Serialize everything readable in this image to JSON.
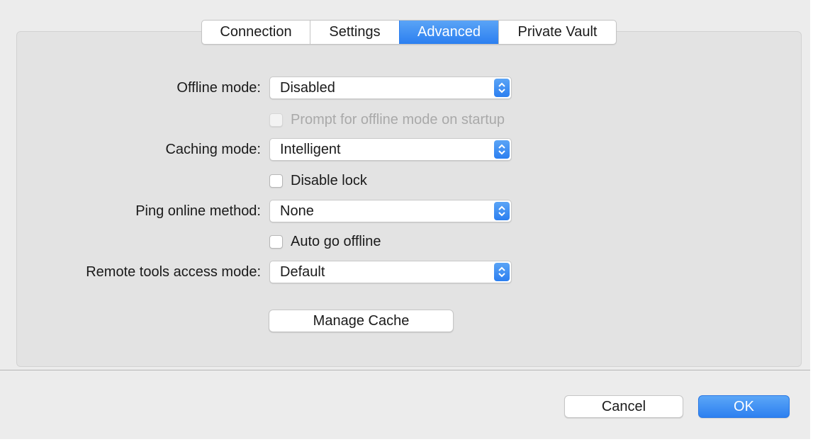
{
  "tabs": [
    {
      "label": "Connection",
      "active": false
    },
    {
      "label": "Settings",
      "active": false
    },
    {
      "label": "Advanced",
      "active": true
    },
    {
      "label": "Private Vault",
      "active": false
    }
  ],
  "form": {
    "offline_mode": {
      "label": "Offline mode:",
      "value": "Disabled"
    },
    "prompt_offline": {
      "label": "Prompt for offline mode on startup",
      "checked": false,
      "enabled": false
    },
    "caching_mode": {
      "label": "Caching mode:",
      "value": "Intelligent"
    },
    "disable_lock": {
      "label": "Disable lock",
      "checked": false,
      "enabled": true
    },
    "ping_method": {
      "label": "Ping online method:",
      "value": "None"
    },
    "auto_offline": {
      "label": "Auto go offline",
      "checked": false,
      "enabled": true
    },
    "remote_tools": {
      "label": "Remote tools access mode:",
      "value": "Default"
    },
    "manage_cache_label": "Manage Cache"
  },
  "footer": {
    "cancel_label": "Cancel",
    "ok_label": "OK"
  },
  "icons": {
    "select_chevron": "chevron-updown-icon"
  },
  "colors": {
    "accent": "#2c7ff0",
    "panel_bg": "#e3e3e3",
    "window_bg": "#ececec"
  }
}
